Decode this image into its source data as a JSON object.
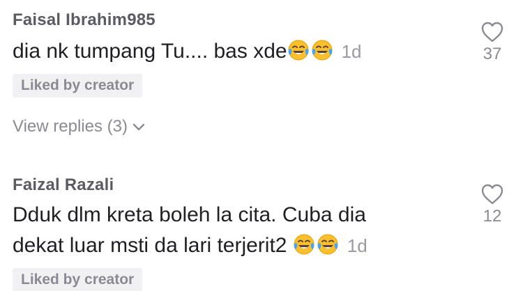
{
  "comments": [
    {
      "author": "Faisal Ibrahim985",
      "text": "dia nk tumpang Tu.... bas xde",
      "emoji": [
        "face-with-tears-of-joy",
        "face-with-tears-of-joy"
      ],
      "time": "1d",
      "badge": "Liked by creator",
      "replies_label": "View replies (3)",
      "likes": "37"
    },
    {
      "author": "Faizal Razali",
      "text_line1": "Dduk dlm kreta boleh la cita. Cuba dia",
      "text_line2": "dekat luar msti da lari terjerit2",
      "emoji": [
        "face-with-tears-of-joy",
        "face-with-tears-of-joy"
      ],
      "time": "1d",
      "badge": "Liked by creator",
      "likes": "12"
    }
  ],
  "colors": {
    "author": "#5b5b63",
    "text": "#1f1f24",
    "muted": "#8a8a92",
    "badge_bg": "#f1f1f3"
  }
}
